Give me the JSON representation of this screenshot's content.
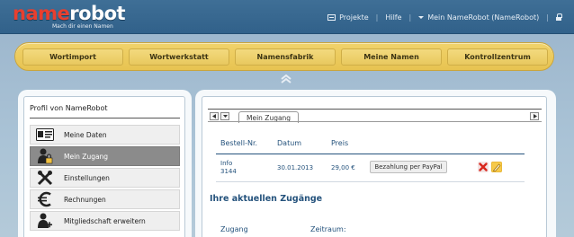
{
  "header": {
    "logo_brand": "namerobot",
    "logo_tagline": "Mach dir einen Namen",
    "nav": {
      "projects": "Projekte",
      "help": "Hilfe",
      "account": "Mein NameRobot (NameRobot)"
    }
  },
  "menu": {
    "items": [
      {
        "label": "Wortimport"
      },
      {
        "label": "Wortwerkstatt"
      },
      {
        "label": "Namensfabrik"
      },
      {
        "label": "Meine Namen"
      },
      {
        "label": "Kontrollzentrum"
      }
    ]
  },
  "sidebar": {
    "title": "Profil von NameRobot",
    "items": [
      {
        "label": "Meine Daten",
        "icon": "id-card-icon",
        "active": false
      },
      {
        "label": "Mein Zugang",
        "icon": "user-lock-icon",
        "active": true
      },
      {
        "label": "Einstellungen",
        "icon": "tools-icon",
        "active": false
      },
      {
        "label": "Rechnungen",
        "icon": "euro-icon",
        "active": false
      },
      {
        "label": "Mitgliedschaft erweitern",
        "icon": "user-add-icon",
        "active": false
      }
    ]
  },
  "main": {
    "tab_label": "Mein Zugang",
    "orders": {
      "headers": {
        "order_no": "Bestell-Nr.",
        "date": "Datum",
        "price": "Preis"
      },
      "rows": [
        {
          "order_line1": "Info",
          "order_line2": "3144",
          "date": "30.01.2013",
          "price": "29,00 €",
          "payment_button": "Bezahlung per PayPal"
        }
      ]
    },
    "section_title": "Ihre aktuellen Zugänge",
    "access_headers": {
      "access": "Zugang",
      "period": "Zeitraum:"
    }
  },
  "colors": {
    "header_blue": "#3a6a92",
    "menu_yellow": "#ecc95a",
    "link_blue": "#24527c",
    "logo_red": "#e83f2f"
  }
}
